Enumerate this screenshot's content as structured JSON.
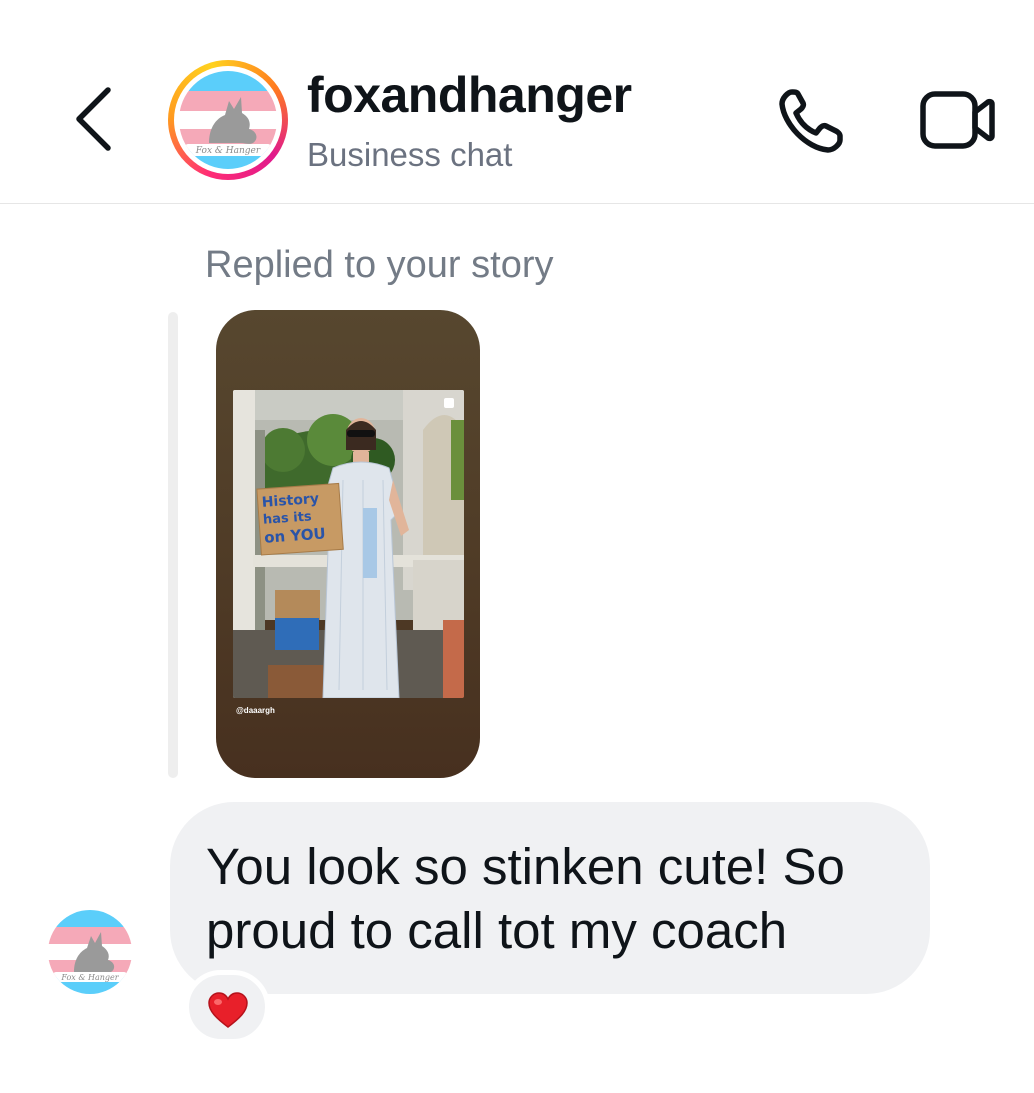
{
  "header": {
    "title": "foxandhanger",
    "subtitle": "Business chat",
    "back_icon": "chevron-left-icon",
    "call_icon": "phone-icon",
    "video_icon": "video-camera-icon",
    "story_ring_colors": [
      "#ff2d75",
      "#ff9a1f",
      "#ffd21f"
    ]
  },
  "avatar": {
    "logo_text": "Fox & Hanger",
    "flag_colors": [
      "#5bcefa",
      "#f5a9b8",
      "#ffffff",
      "#f5a9b8",
      "#5bcefa"
    ]
  },
  "story_reply": {
    "label": "Replied to your story",
    "story_handle": "@daaargh",
    "sign_text": [
      "History",
      "has its",
      "on YOU"
    ]
  },
  "message": {
    "text": "You look so stinken cute! So proud to call tot my coach",
    "bubble_color": "#f0f1f3",
    "reaction": "❤️"
  }
}
